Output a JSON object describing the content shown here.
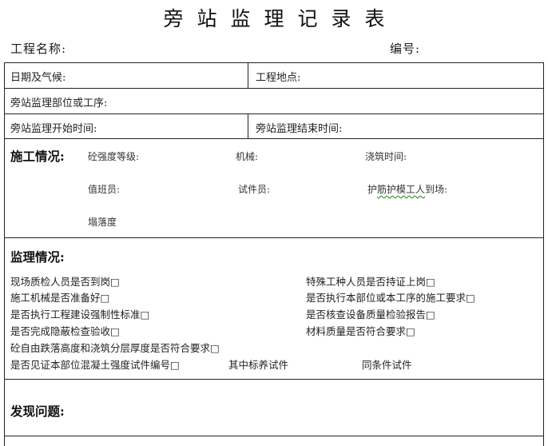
{
  "title": "旁站监理记录表",
  "header": {
    "project_name_label": "工程名称:",
    "serial_label": "编号:"
  },
  "rows": {
    "date_weather": "日期及气候:",
    "location": "工程地点:",
    "part_process": "旁站监理部位或工序:",
    "start_time": "旁站监理开始时间:",
    "end_time": "旁站监理结束时间:"
  },
  "construction": {
    "title": "施工情况:",
    "concrete_grade": "砼强度等级:",
    "machinery": "机械:",
    "pour_time": "浇筑时间:",
    "duty_staff": "值班员:",
    "tester": "试件员:",
    "rebar_worker_prefix": "护",
    "rebar_worker_marked": "筋护模工人",
    "rebar_worker_suffix": "到场:",
    "slump": "塌落度"
  },
  "supervision": {
    "title": "监理情况:",
    "items_left": [
      "现场质检人员是否到岗□",
      "施工机械是否准备好□",
      "是否执行工程建设强制性标准□",
      "是否完成隐蔽检查验收□"
    ],
    "items_right": [
      "特殊工种人员是否持证上岗□",
      "是否执行本部位或本工序的施工要求□",
      "是否核查设备质量检验报告□",
      "材料质量是否符合要求□"
    ],
    "free_height_item": "砼自由跌落高度和浇筑分层厚度是否符合要求□",
    "specimen_item": "是否见证本部位混凝土强度试件编号□",
    "standard_cure": "其中标养试件",
    "same_condition": "同条件试件"
  },
  "problems": {
    "title": "发现问题:"
  }
}
